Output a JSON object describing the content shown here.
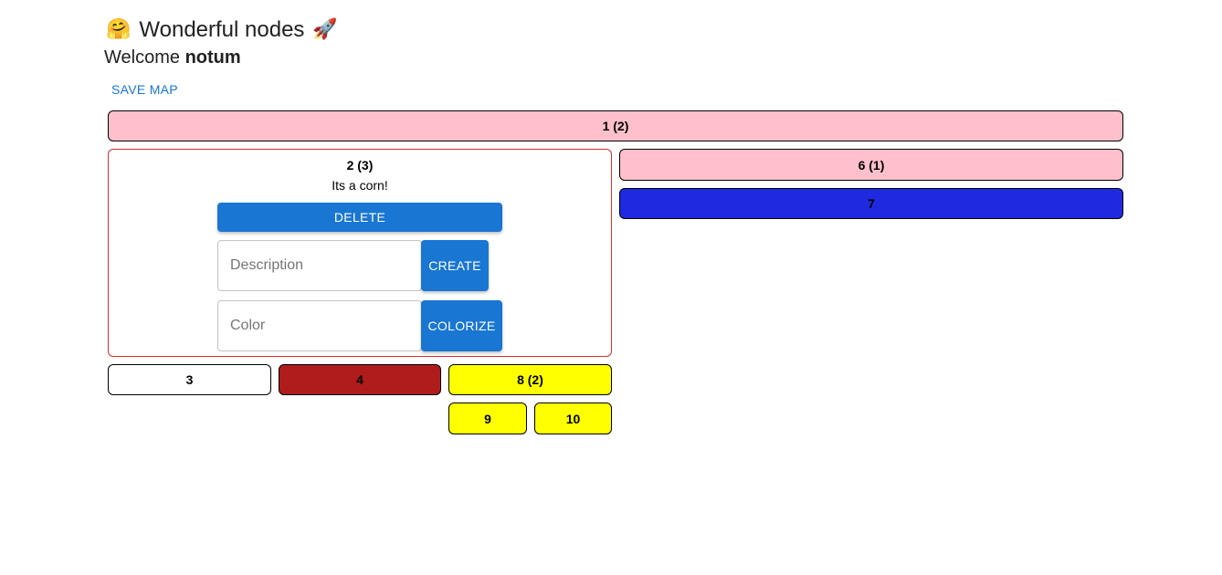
{
  "header": {
    "title": "Wonderful nodes",
    "leading_icon": "hugging-face-icon",
    "leading_glyph": "🤗",
    "trailing_icon": "rocket-icon",
    "trailing_glyph": "🚀",
    "welcome_prefix": "Welcome",
    "username": "notum"
  },
  "toolbar": {
    "save_map_label": "SAVE MAP"
  },
  "nodes": {
    "n1": {
      "label": "1 (2)",
      "color": "#ffc0cb"
    },
    "n2": {
      "label": "2 (3)",
      "description": "Its a corn!",
      "border_color": "#d32f2f",
      "delete_label": "DELETE",
      "description_placeholder": "Description",
      "create_label": "CREATE",
      "color_placeholder": "Color",
      "colorize_label": "COLORIZE"
    },
    "n3": {
      "label": "3",
      "color": "#ffffff"
    },
    "n4": {
      "label": "4",
      "color": "#b01c1c"
    },
    "n6": {
      "label": "6 (1)",
      "color": "#ffc0cb"
    },
    "n7": {
      "label": "7",
      "color": "#1f2ae0"
    },
    "n8": {
      "label": "8 (2)",
      "color": "#ffff00"
    },
    "n9": {
      "label": "9",
      "color": "#ffff00"
    },
    "n10": {
      "label": "10",
      "color": "#ffff00"
    }
  },
  "colors": {
    "accent": "#1976d2",
    "selected_border": "#d32f2f"
  }
}
